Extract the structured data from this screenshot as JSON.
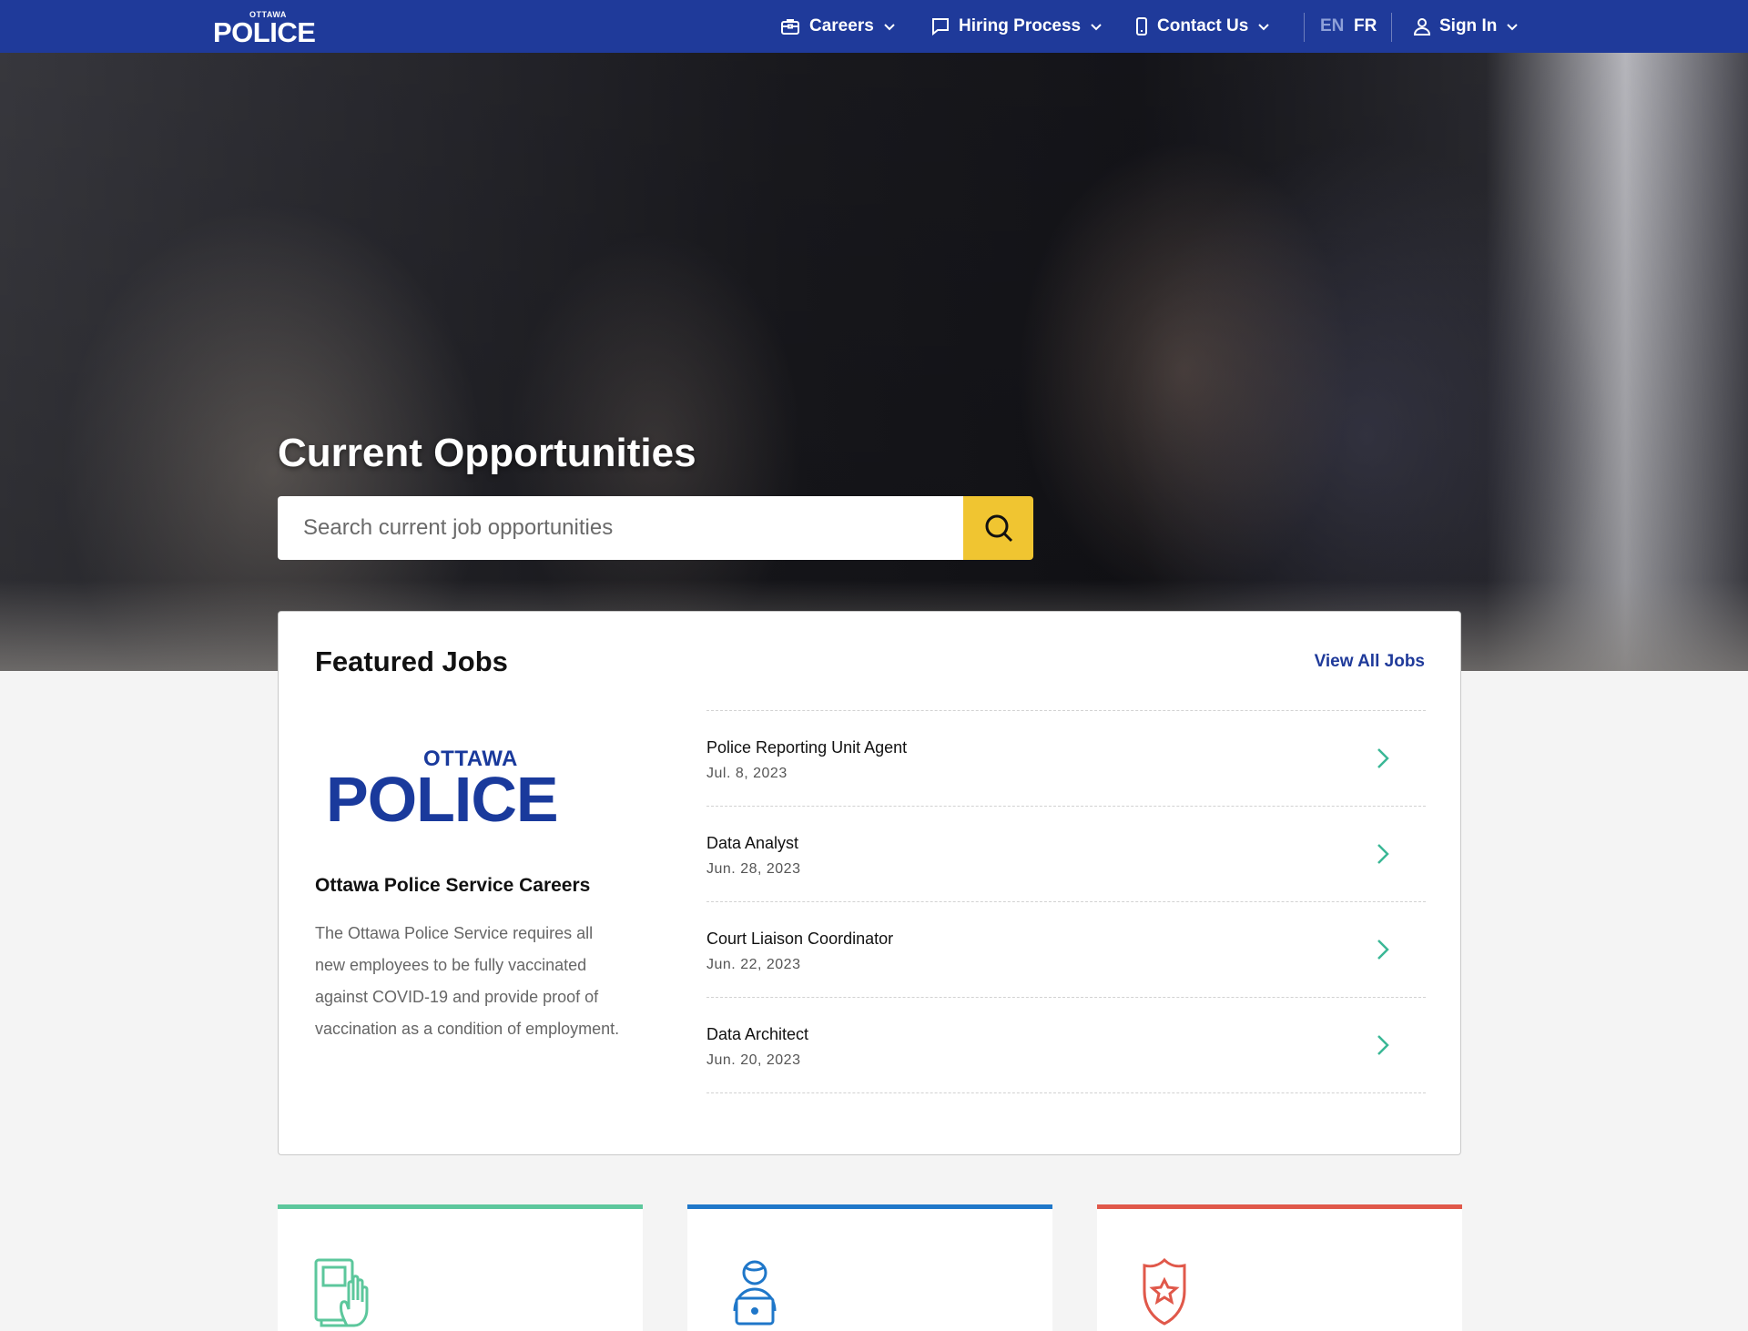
{
  "header": {
    "logo": {
      "small": "OTTAWA",
      "big": "POLICE"
    },
    "nav": [
      {
        "label": "Careers",
        "icon": "briefcase-icon"
      },
      {
        "label": "Hiring Process",
        "icon": "chat-icon"
      },
      {
        "label": "Contact Us",
        "icon": "phone-icon"
      }
    ],
    "lang": {
      "en": "EN",
      "fr": "FR"
    },
    "sign_in": "Sign In"
  },
  "hero": {
    "title": "Current Opportunities",
    "search_placeholder": "Search current job opportunities"
  },
  "featured": {
    "title": "Featured Jobs",
    "view_all": "View All Jobs",
    "logo": {
      "small": "OTTAWA",
      "big": "POLICE"
    },
    "subtitle": "Ottawa Police Service Careers",
    "description": "The Ottawa Police Service requires all new employees to be fully vaccinated against COVID-19 and provide proof of vaccination as a condition of employment.",
    "jobs": [
      {
        "title": "Police Reporting Unit Agent",
        "date": "Jul. 8, 2023"
      },
      {
        "title": "Data Analyst",
        "date": "Jun. 28, 2023"
      },
      {
        "title": "Court Liaison Coordinator",
        "date": "Jun. 22, 2023"
      },
      {
        "title": "Data Architect",
        "date": "Jun. 20, 2023"
      }
    ]
  },
  "colors": {
    "nav_bg": "#1f3a9a",
    "search_button": "#f0c531",
    "chevron": "#3ab795",
    "card_green": "#5cc79c",
    "card_blue": "#1f77c9",
    "card_red": "#e0584a"
  },
  "bottom_cards": [
    {
      "icon": "handbook-icon",
      "color": "#5cc79c"
    },
    {
      "icon": "laptop-user-icon",
      "color": "#1f77c9"
    },
    {
      "icon": "police-badge-icon",
      "color": "#e0584a"
    }
  ]
}
